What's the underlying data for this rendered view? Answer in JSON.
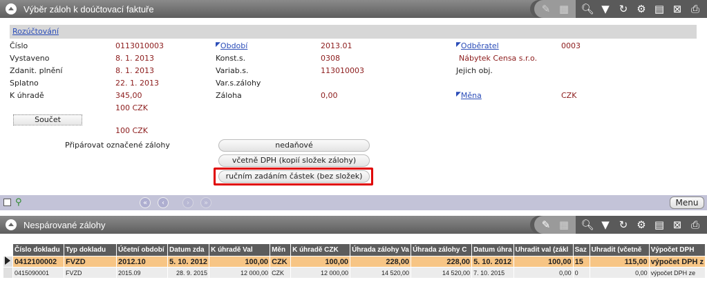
{
  "panel1": {
    "title": "Výběr záloh k doúčtovací faktuře"
  },
  "subheader": {
    "link": "Rozúčtování"
  },
  "fields": {
    "cislo": {
      "label": "Číslo",
      "value": "0113010003"
    },
    "vystaveno": {
      "label": "Vystaveno",
      "value": "8. 1. 2013"
    },
    "zdanit": {
      "label": "Zdanit. plnění",
      "value": "8. 1. 2013"
    },
    "splatno": {
      "label": "Splatno",
      "value": "22. 1. 2013"
    },
    "kuhrade": {
      "label": "K úhradě",
      "value": "345,00"
    },
    "amount1": "100  CZK",
    "amount2": "100  CZK",
    "obdobi": {
      "label": "Období",
      "value": "2013.01"
    },
    "konst": {
      "label": "Konst.s.",
      "value": "0308"
    },
    "varia": {
      "label": "Variab.s.",
      "value": "113010003"
    },
    "varzal": {
      "label": "Var.s.zálohy",
      "value": ""
    },
    "zaloha": {
      "label": "Záloha",
      "value": "0,00"
    },
    "odberatel": {
      "label": "Odběratel",
      "value": "0003"
    },
    "firma": "Nábytek Censa s.r.o.",
    "jejich": {
      "label": "Jejich obj.",
      "value": ""
    },
    "mena": {
      "label": "Měna",
      "value": "CZK"
    }
  },
  "buttons": {
    "soucet": "Součet",
    "priparovat": "Připárovat označené zálohy",
    "nedanove": "nedaňové",
    "vcetne": "včetně DPH (kopií složek zálohy)",
    "rucnim": "ručním zadáním částek (bez složek)"
  },
  "nav": {
    "menu": "Menu"
  },
  "panel2": {
    "title": "Nespárované zálohy"
  },
  "table": {
    "headers": [
      "Číslo dokladu",
      "Typ dokladu",
      "Účetní období",
      "Datum zda",
      "K úhradě Val",
      "Měn",
      "K úhradě CZK",
      "Úhrada zálohy Va",
      "Úhrada zálohy C",
      "Datum úhra",
      "Uhradit val (zákl",
      "Saz",
      "Uhradit (včetně",
      "Výpočet DPH"
    ],
    "rows": [
      [
        "0412100002",
        "FVZD",
        "2012.10",
        "5. 10. 2012",
        "100,00",
        "CZK",
        "100,00",
        "228,00",
        "228,00",
        "5. 10. 2012",
        "100,00",
        "15",
        "115,00",
        "výpočet DPH z"
      ],
      [
        "0415090001",
        "FVZD",
        "2015.09",
        "28. 9. 2015",
        "12 000,00",
        "CZK",
        "12 000,00",
        "14 520,00",
        "14 520,00",
        "7. 10. 2015",
        "0,00",
        "0",
        "0,00",
        "výpočet DPH ze"
      ]
    ]
  },
  "colors": {
    "header_bg": "#6e6e6e",
    "value_text": "#8b1a1a",
    "link": "#2a4cb8",
    "nav_bar": "#c3c3d8",
    "selected_row": "#f7c585",
    "highlight": "#e00000"
  }
}
